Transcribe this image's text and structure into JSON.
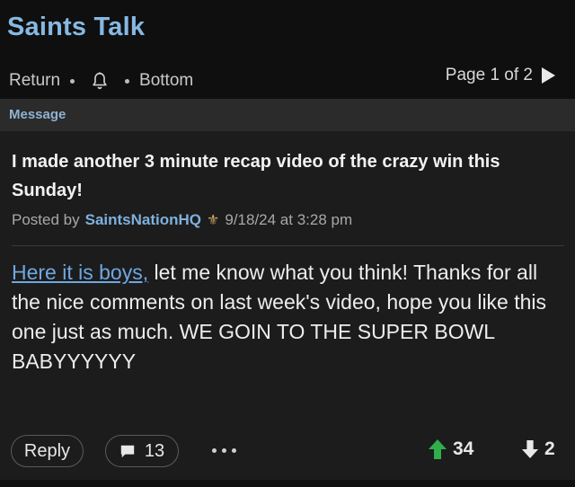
{
  "header": {
    "app_title": "Saints Talk",
    "nav": {
      "return_label": "Return",
      "bell_icon": "bell-icon",
      "bottom_label": "Bottom"
    },
    "pager": {
      "label": "Page 1 of 2",
      "next_icon": "play-arrow-icon"
    }
  },
  "section": {
    "title": "Message"
  },
  "post": {
    "title": "I made another 3 minute recap video of the crazy win this Sunday!",
    "posted_by_prefix": "Posted by",
    "author": "SaintsNationHQ",
    "author_badge_icon": "fleur-de-lis-icon",
    "timestamp": "9/18/24 at 3:28 pm",
    "link_text": "Here it is boys,",
    "body_text": " let me know what you think! Thanks for all the nice comments on last week's video, hope you like this one just as much. WE GOIN TO THE SUPER BOWL BABYYYYYY"
  },
  "actions": {
    "reply_label": "Reply",
    "comment_count": "13",
    "upvotes": "34",
    "downvotes": "2"
  },
  "colors": {
    "title_blue": "#86b9e3",
    "author_blue": "#7fb0de",
    "link_blue": "#6ea8e0",
    "upvote_green": "#2fae4a",
    "background": "#1c1c1c"
  }
}
